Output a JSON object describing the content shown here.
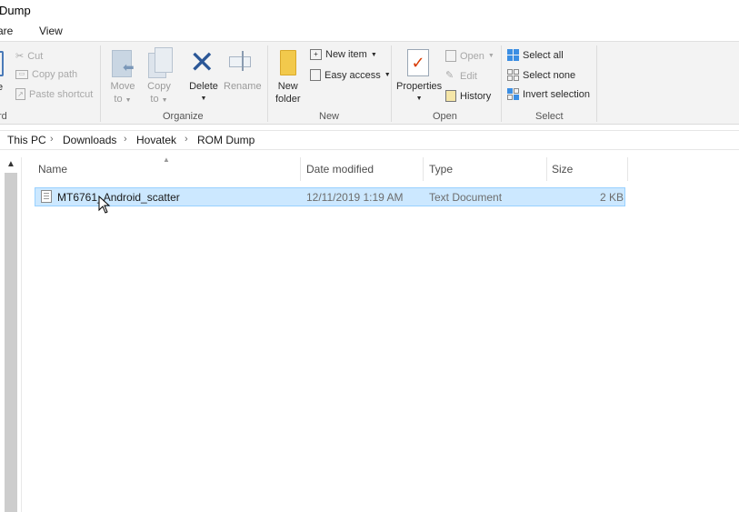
{
  "window": {
    "title": "Dump"
  },
  "tabs": [
    {
      "label": "are"
    },
    {
      "label": "View"
    }
  ],
  "ribbon": {
    "clipboard": {
      "cut": "Cut",
      "copy_path": "Copy path",
      "paste_shortcut": "Paste shortcut",
      "group_label": "rd",
      "left_fragment": "e"
    },
    "organize": {
      "move_to": [
        "Move",
        "to"
      ],
      "copy_to": [
        "Copy",
        "to"
      ],
      "delete": "Delete",
      "rename": "Rename",
      "group_label": "Organize"
    },
    "new": {
      "new_folder": [
        "New",
        "folder"
      ],
      "new_item": "New item",
      "easy_access": "Easy access",
      "group_label": "New"
    },
    "open": {
      "properties": "Properties",
      "open": "Open",
      "edit": "Edit",
      "history": "History",
      "group_label": "Open"
    },
    "select": {
      "select_all": "Select all",
      "select_none": "Select none",
      "invert_selection": "Invert selection",
      "group_label": "Select"
    }
  },
  "breadcrumb": [
    "This PC",
    "Downloads",
    "Hovatek",
    "ROM Dump"
  ],
  "columns": {
    "name": "Name",
    "date_modified": "Date modified",
    "type": "Type",
    "size": "Size"
  },
  "files": [
    {
      "name": "MT6761_Android_scatter",
      "date_modified": "12/11/2019 1:19 AM",
      "type": "Text Document",
      "size": "2 KB"
    }
  ],
  "colors": {
    "selection": "#cce8ff",
    "selection_border": "#99d1ff",
    "accent": "#0078d7",
    "delete_x": "#2b5797",
    "checkmark": "#d83b01"
  }
}
